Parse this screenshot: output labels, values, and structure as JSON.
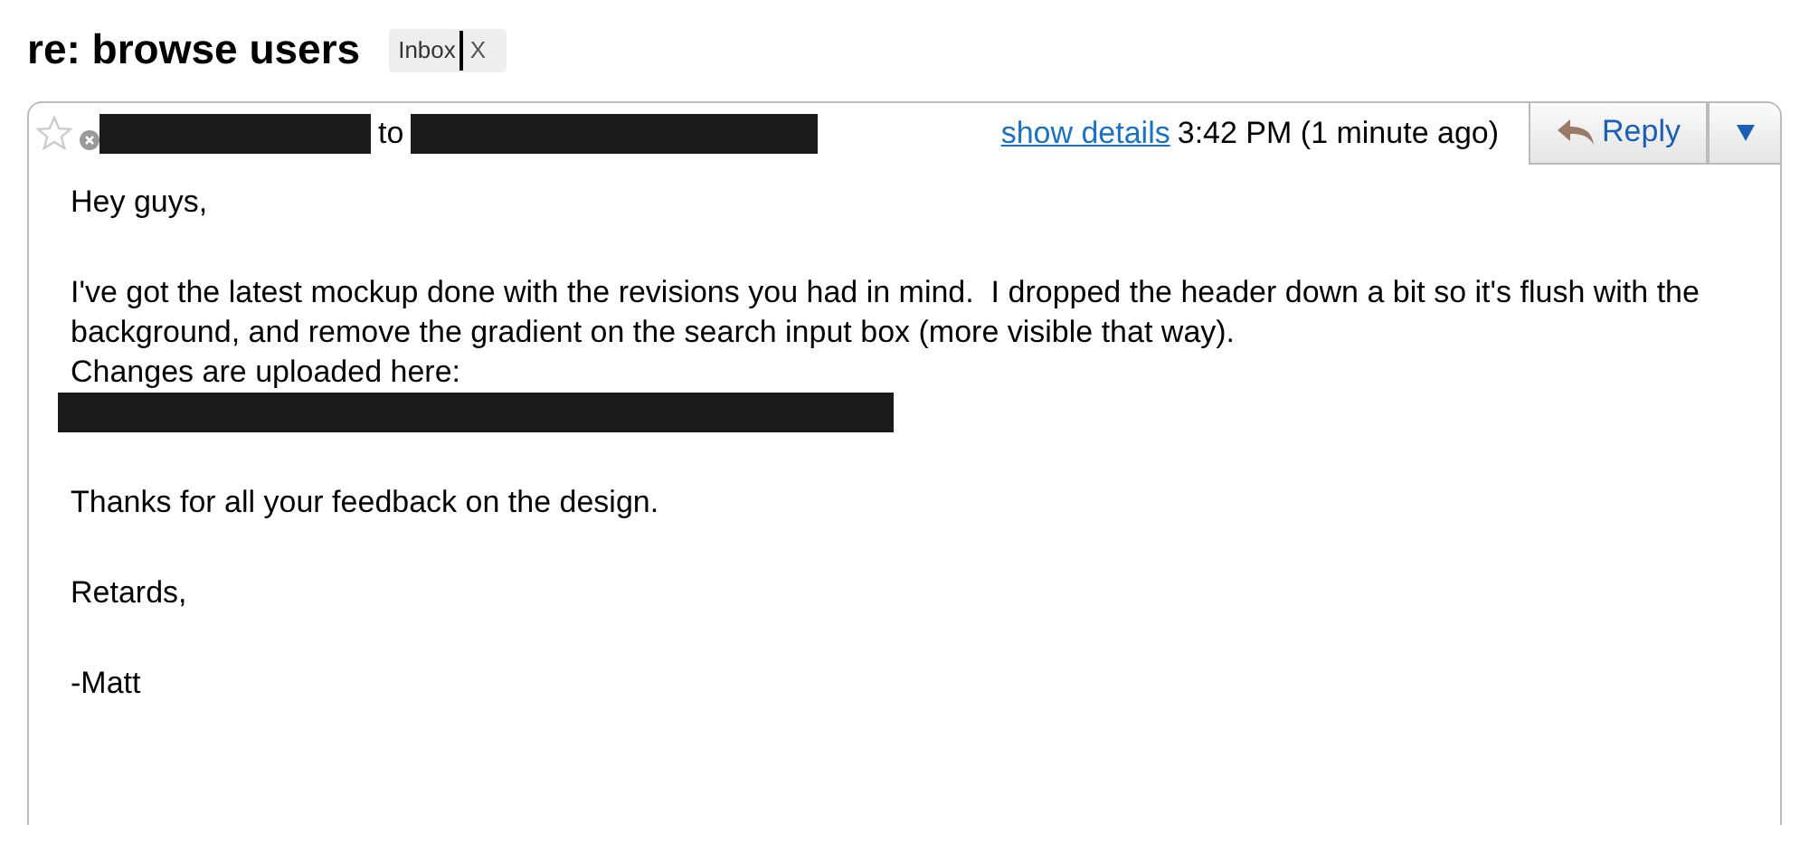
{
  "subject": "re: browse users",
  "label": {
    "text": "Inbox",
    "remove": "X"
  },
  "message": {
    "starred": false,
    "to": "to",
    "show_details": "show details",
    "time": "3:42 PM (1 minute ago)",
    "reply": "Reply",
    "body": [
      {
        "kind": "text",
        "text": "Hey guys,"
      },
      {
        "kind": "gap"
      },
      {
        "kind": "text",
        "text": "I've got the latest mockup done with the revisions you had in mind.  I dropped the header down a bit so it's flush with the background, and remove the gradient on the search input box (more visible that way)."
      },
      {
        "kind": "text",
        "text": "Changes are uploaded here:"
      },
      {
        "kind": "redacted"
      },
      {
        "kind": "gap"
      },
      {
        "kind": "text",
        "text": "Thanks for all your feedback on the design."
      },
      {
        "kind": "gap"
      },
      {
        "kind": "text",
        "text": "Retards,"
      },
      {
        "kind": "gap"
      },
      {
        "kind": "text",
        "text": "-Matt"
      }
    ]
  }
}
